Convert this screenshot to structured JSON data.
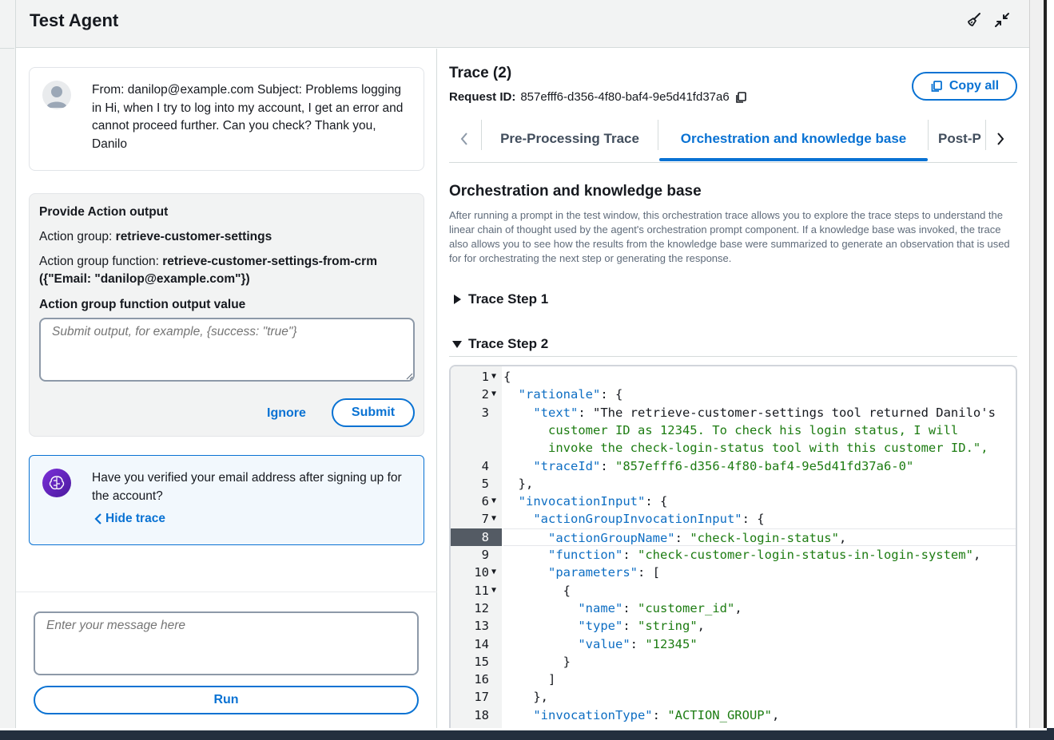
{
  "window": {
    "title": "Test Agent"
  },
  "header": {
    "clean_icon": "broom-icon",
    "minimize_icon": "collapse-arrows-icon"
  },
  "chat": {
    "user_message": "From: danilop@example.com Subject: Problems logging in Hi, when I try to log into my account, I get an error and cannot proceed further. Can you check? Thank you, Danilo",
    "action_card": {
      "title": "Provide Action output",
      "action_group_label": "Action group: ",
      "action_group_value": "retrieve-customer-settings",
      "function_label": "Action group function: ",
      "function_value": "retrieve-customer-settings-from-crm ({\"Email: \"danilop@example.com\"})",
      "output_label": "Action group function output value",
      "output_placeholder": "Submit output, for example, {success: \"true\"}",
      "ignore_label": "Ignore",
      "submit_label": "Submit"
    },
    "agent_message": "Have you verified your email address after signing up for the account?",
    "hide_trace_label": "Hide trace",
    "input_placeholder": "Enter your message here",
    "run_label": "Run"
  },
  "trace": {
    "title": "Trace (2)",
    "request_id_label": "Request ID:",
    "request_id": "857efff6-d356-4f80-baf4-9e5d41fd37a6",
    "copy_all_label": "Copy all",
    "tabs": [
      {
        "label": "Pre-Processing Trace",
        "active": false
      },
      {
        "label": "Orchestration and knowledge base",
        "active": true
      },
      {
        "label": "Post-P",
        "active": false
      }
    ],
    "section_title": "Orchestration and knowledge base",
    "section_description": "After running a prompt in the test window, this orchestration trace allows you to explore the trace steps to understand the linear chain of thought used by the agent's orchestration prompt component. If a knowledge base was invoked, the trace also allows you to see how the results from the knowledge base were summarized to generate an observation that is used for for orchestrating the next step or generating the response.",
    "steps": [
      {
        "label": "Trace Step 1",
        "expanded": false
      },
      {
        "label": "Trace Step 2",
        "expanded": true
      }
    ],
    "code_lines": [
      {
        "n": "1",
        "fold": true,
        "text": "{"
      },
      {
        "n": "2",
        "fold": true,
        "text": "  \"rationale\": {"
      },
      {
        "n": "3",
        "fold": false,
        "text": "    \"text\": \"The retrieve-customer-settings tool returned Danilo's"
      },
      {
        "n": "",
        "fold": false,
        "text": "      customer ID as 12345. To check his login status, I will"
      },
      {
        "n": "",
        "fold": false,
        "text": "      invoke the check-login-status tool with this customer ID.\","
      },
      {
        "n": "4",
        "fold": false,
        "text": "    \"traceId\": \"857efff6-d356-4f80-baf4-9e5d41fd37a6-0\""
      },
      {
        "n": "5",
        "fold": false,
        "text": "  },"
      },
      {
        "n": "6",
        "fold": true,
        "text": "  \"invocationInput\": {"
      },
      {
        "n": "7",
        "fold": true,
        "text": "    \"actionGroupInvocationInput\": {"
      },
      {
        "n": "8",
        "fold": false,
        "text": "      \"actionGroupName\": \"check-login-status\",",
        "highlight": true
      },
      {
        "n": "9",
        "fold": false,
        "text": "      \"function\": \"check-customer-login-status-in-login-system\","
      },
      {
        "n": "10",
        "fold": true,
        "text": "      \"parameters\": ["
      },
      {
        "n": "11",
        "fold": true,
        "text": "        {"
      },
      {
        "n": "12",
        "fold": false,
        "text": "          \"name\": \"customer_id\","
      },
      {
        "n": "13",
        "fold": false,
        "text": "          \"type\": \"string\","
      },
      {
        "n": "14",
        "fold": false,
        "text": "          \"value\": \"12345\""
      },
      {
        "n": "15",
        "fold": false,
        "text": "        }"
      },
      {
        "n": "16",
        "fold": false,
        "text": "      ]"
      },
      {
        "n": "17",
        "fold": false,
        "text": "    },"
      },
      {
        "n": "18",
        "fold": false,
        "text": "    \"invocationType\": \"ACTION_GROUP\","
      }
    ]
  },
  "colors": {
    "accent": "#0972d3",
    "code_key": "#0e6ec3",
    "code_string": "#1d7c12"
  }
}
